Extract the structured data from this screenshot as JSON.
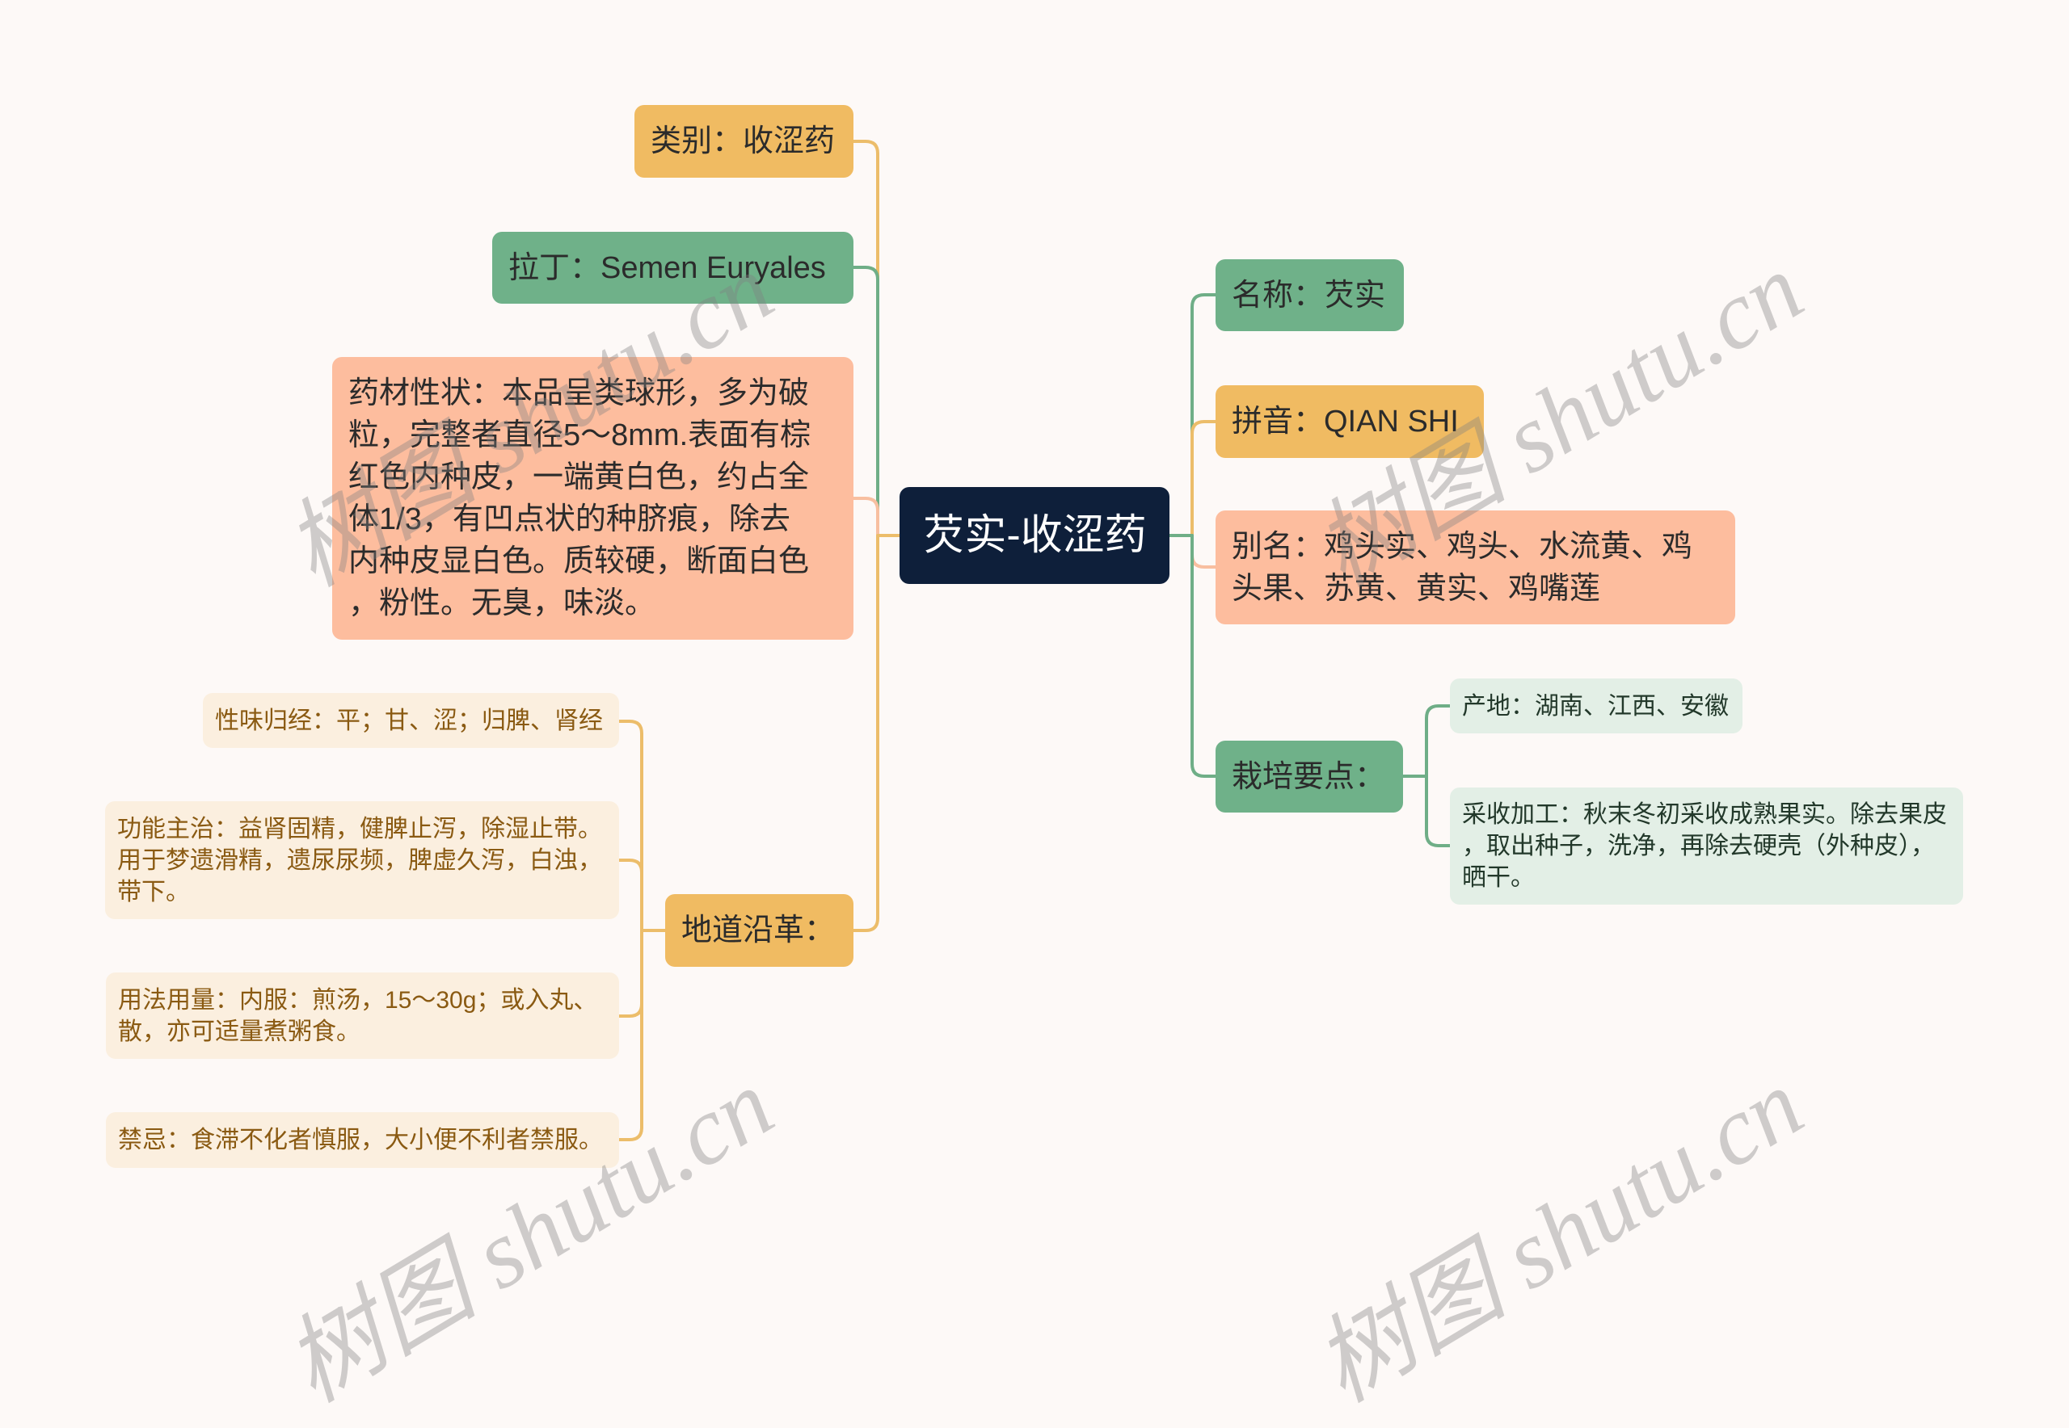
{
  "palette": {
    "background": "#fdf9f7",
    "root": "#0e1f3a",
    "yellow": "#f0bb62",
    "green": "#6fb189",
    "salmon": "#fdbd9e",
    "beige": "#fbefdf",
    "light_green": "#e3efe6",
    "line_yellow": "#ecbd6a",
    "line_green": "#6fae87",
    "line_salmon": "#f8bfa0"
  },
  "root": {
    "label": "芡实-收涩药"
  },
  "left": [
    {
      "lines": [
        "类别：收涩药"
      ]
    },
    {
      "lines": [
        "拉丁：Semen Euryales"
      ]
    },
    {
      "lines": [
        "药材性状：本品呈类球形，多为破",
        "粒，完整者直径5～8mm.表面有棕",
        "红色内种皮，一端黄白色，约占全",
        "体1/3，有凹点状的种脐痕，除去",
        "内种皮显白色。质较硬，断面白色",
        "，粉性。无臭，味淡。"
      ]
    },
    {
      "lines": [
        "地道沿革："
      ],
      "children": [
        {
          "lines": [
            "性味归经：平；甘、涩；归脾、肾经"
          ]
        },
        {
          "lines": [
            "功能主治：益肾固精，健脾止泻，除湿止带。",
            "用于梦遗滑精，遗尿尿频，脾虚久泻，白浊，",
            "带下。"
          ]
        },
        {
          "lines": [
            "用法用量：内服：煎汤，15～30g；或入丸、",
            "散，亦可适量煮粥食。"
          ]
        },
        {
          "lines": [
            "禁忌：食滞不化者慎服，大小便不利者禁服。"
          ]
        }
      ]
    }
  ],
  "right": [
    {
      "lines": [
        "名称：芡实"
      ]
    },
    {
      "lines": [
        "拼音：QIAN SHI"
      ]
    },
    {
      "lines": [
        "别名：鸡头实、鸡头、水流黄、鸡",
        "头果、苏黄、黄实、鸡嘴莲"
      ]
    },
    {
      "lines": [
        "栽培要点："
      ],
      "children": [
        {
          "lines": [
            "产地：湖南、江西、安徽"
          ]
        },
        {
          "lines": [
            "采收加工：秋末冬初采收成熟果实。除去果皮",
            "，取出种子，洗净，再除去硬壳（外种皮），",
            "晒干。"
          ]
        }
      ]
    }
  ],
  "watermark": "树图 shutu.cn"
}
